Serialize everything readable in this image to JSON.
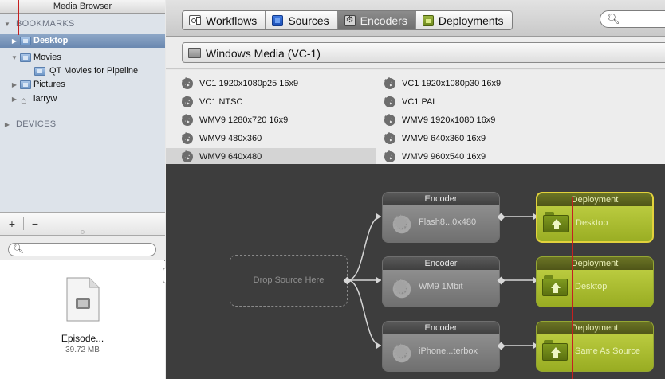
{
  "media_browser": {
    "title": "Media Browser",
    "bookmarks_label": "BOOKMARKS",
    "devices_label": "DEVICES",
    "items": [
      {
        "label": "Desktop"
      },
      {
        "label": "Movies"
      },
      {
        "label": "QT Movies for Pipeline"
      },
      {
        "label": "Pictures"
      },
      {
        "label": "larryw"
      }
    ],
    "add_label": "+",
    "remove_label": "−",
    "search_icon": "magnifier",
    "file": {
      "name": "Episode...",
      "size": "39.72 MB"
    }
  },
  "toolbar": {
    "tabs": [
      {
        "label": "Workflows",
        "icon": "workflow-icon"
      },
      {
        "label": "Sources",
        "icon": "sources-icon"
      },
      {
        "label": "Encoders",
        "icon": "encoder-icon",
        "active": true
      },
      {
        "label": "Deployments",
        "icon": "deployment-icon"
      }
    ],
    "search_icon": "magnifier",
    "search_value": ""
  },
  "format": {
    "selected": "Windows Media (VC-1)"
  },
  "encoders": [
    {
      "label": "VC1 1920x1080p25 16x9"
    },
    {
      "label": "VC1 1920x1080p30 16x9"
    },
    {
      "label": "VC1 NTSC"
    },
    {
      "label": "VC1 PAL"
    },
    {
      "label": "WMV9 1280x720 16x9"
    },
    {
      "label": "WMV9 1920x1080 16x9"
    },
    {
      "label": "WMV9 480x360"
    },
    {
      "label": "WMV9 640x360 16x9"
    },
    {
      "label": "WMV9 640x480",
      "selected": true
    },
    {
      "label": "WMV9 960x540 16x9"
    }
  ],
  "workflow": {
    "drop_source_label": "Drop Source Here",
    "encoders": [
      {
        "title": "Encoder",
        "label": "Flash8...0x480"
      },
      {
        "title": "Encoder",
        "label": "WM9 1Mbit"
      },
      {
        "title": "Encoder",
        "label": "iPhone...terbox"
      }
    ],
    "deployments": [
      {
        "title": "Deployment",
        "label": "Desktop",
        "highlight": true
      },
      {
        "title": "Deployment",
        "label": "Desktop"
      },
      {
        "title": "Deployment",
        "label": "Same As Source"
      }
    ]
  },
  "colors": {
    "canvas": "#3d3d3d",
    "deployment_green": "#a6b92f",
    "highlight_yellow": "#e2d23c",
    "annotation_red": "#c62020",
    "selection_blue": "#6a88b0"
  }
}
